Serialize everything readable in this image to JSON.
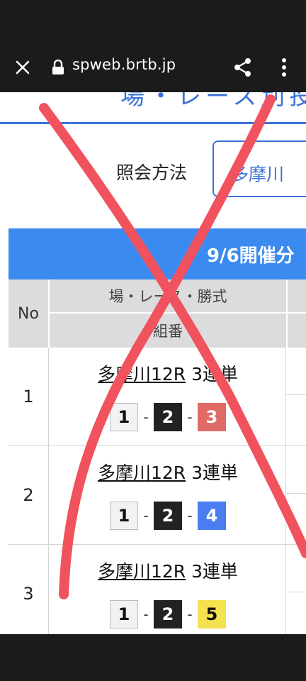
{
  "browser": {
    "url": "spweb.brtb.jp",
    "icons": [
      "close-icon",
      "lock-icon",
      "share-icon",
      "more-vert-icon"
    ]
  },
  "page": {
    "title_partial": "場・レース別投",
    "method_label": "照会方法",
    "method_value": "多摩川",
    "banner": "9/6開催分"
  },
  "table": {
    "headers": {
      "no": "No",
      "race": "場・レース・勝式",
      "kumiban": "組番"
    },
    "rows": [
      {
        "no": "1",
        "venue_race": "多摩川12R",
        "bet_type": "3連単",
        "n1": "1",
        "n2": "2",
        "n3": "3",
        "n3_color": "red"
      },
      {
        "no": "2",
        "venue_race": "多摩川12R",
        "bet_type": "3連単",
        "n1": "1",
        "n2": "2",
        "n3": "4",
        "n3_color": "blue"
      },
      {
        "no": "3",
        "venue_race": "多摩川12R",
        "bet_type": "3連単",
        "n1": "1",
        "n2": "2",
        "n3": "5",
        "n3_color": "yellow"
      }
    ],
    "separator": "-"
  },
  "overlay": {
    "annotation": "red-x-mark",
    "color": "#f0525e"
  },
  "colors": {
    "accent": "#3d73d6",
    "banner": "#3b8af0",
    "chrome": "#1b1b1b"
  }
}
